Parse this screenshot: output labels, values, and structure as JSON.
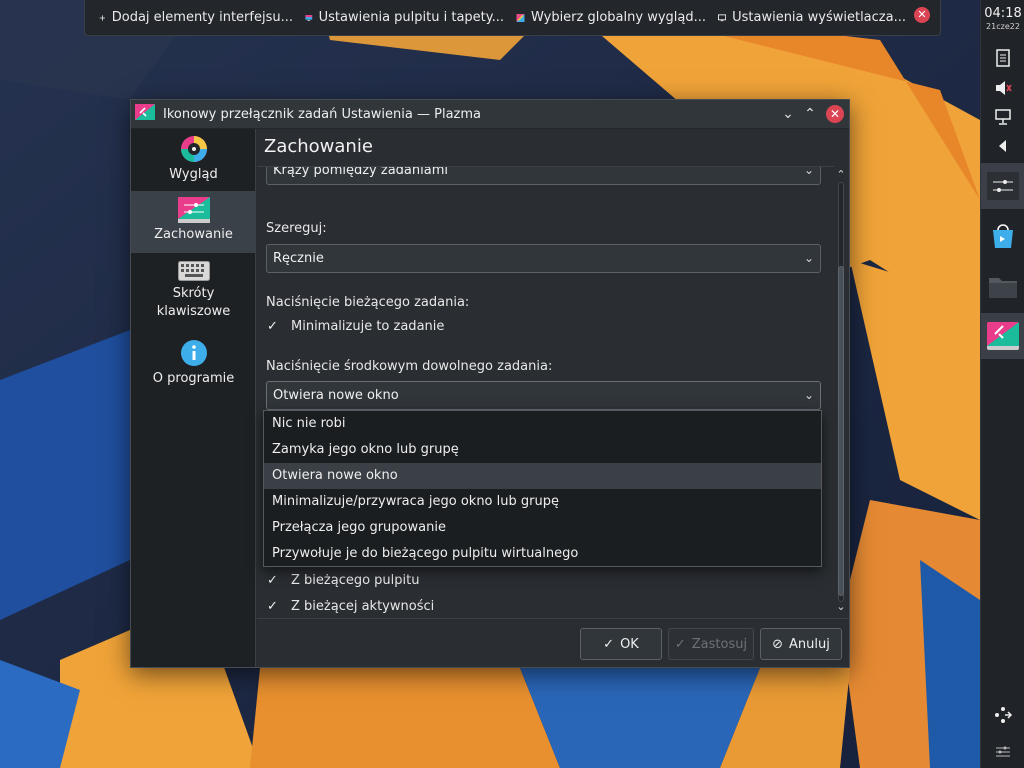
{
  "taskbar": {
    "tasks": [
      {
        "label": "Dodaj elementy interfejsu...",
        "icon": "plus-icon"
      },
      {
        "label": "Ustawienia pulpitu i tapety...",
        "icon": "desktop-settings-icon"
      },
      {
        "label": "Wybierz globalny wygląd...",
        "icon": "global-theme-icon"
      },
      {
        "label": "Ustawienia wyświetlacza...",
        "icon": "display-icon"
      }
    ]
  },
  "panel": {
    "time": "04:18",
    "date": "21cze22"
  },
  "dialog": {
    "title": "Ikonowy przełącznik zadań Ustawienia — Plazma",
    "page_title": "Zachowanie",
    "sidebar": [
      {
        "label": "Wygląd",
        "icon": "appearance-icon"
      },
      {
        "label": "Zachowanie",
        "icon": "behavior-icon"
      },
      {
        "label": "Skróty klawiszowe",
        "icon": "keyboard-icon"
      },
      {
        "label": "O programie",
        "icon": "info-icon"
      }
    ],
    "top_combo_value": "Krąży pomiędzy zadaniami",
    "sort_label": "Szereguj:",
    "sort_value": "Ręcznie",
    "click_current_label": "Naciśnięcie bieżącego zadania:",
    "minimize_check": "Minimalizuje to zadanie",
    "middle_click_label": "Naciśnięcie środkowym dowolnego zadania:",
    "middle_click_value": "Otwiera nowe okno",
    "dropdown_options": [
      "Nic nie robi",
      "Zamyka jego okno lub grupę",
      "Otwiera nowe okno",
      "Minimalizuje/przywraca jego okno lub grupę",
      "Przełącza jego grupowanie",
      "Przywołuje je do bieżącego pulpitu wirtualnego"
    ],
    "dropdown_selected_index": 2,
    "filter_checks": [
      "Z bieżącego pulpitu",
      "Z bieżącej aktywności"
    ],
    "buttons": {
      "ok": "OK",
      "apply": "Zastosuj",
      "cancel": "Anuluj"
    }
  }
}
